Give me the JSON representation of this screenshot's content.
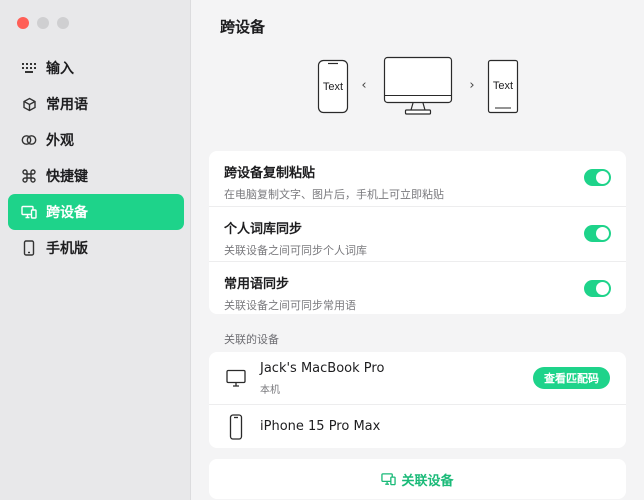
{
  "sidebar": {
    "items": [
      {
        "label": "输入",
        "icon": "keyboard-icon"
      },
      {
        "label": "常用语",
        "icon": "cube-icon"
      },
      {
        "label": "外观",
        "icon": "rings-icon"
      },
      {
        "label": "快捷键",
        "icon": "command-icon"
      },
      {
        "label": "跨设备",
        "icon": "devices-icon",
        "active": true
      },
      {
        "label": "手机版",
        "icon": "phone-icon"
      }
    ]
  },
  "main": {
    "title": "跨设备",
    "illustration": {
      "left_phone_text": "Text",
      "right_phone_text": "Text",
      "prev_arrow": "‹",
      "next_arrow": "›"
    },
    "settings": [
      {
        "title": "跨设备复制粘贴",
        "subtitle": "在电脑复制文字、图片后，手机上可立即粘贴",
        "enabled": true
      },
      {
        "title": "个人词库同步",
        "subtitle": "关联设备之间可同步个人词库",
        "enabled": true
      },
      {
        "title": "常用语同步",
        "subtitle": "关联设备之间可同步常用语",
        "enabled": true
      }
    ],
    "devices_label": "关联的设备",
    "devices": [
      {
        "name": "Jack's MacBook Pro",
        "sub": "本机",
        "button": "查看匹配码"
      },
      {
        "name": "iPhone 15 Pro Max"
      }
    ],
    "link_button": "关联设备"
  },
  "colors": {
    "accent": "#1ed38a",
    "accent_text": "#1aba78",
    "sidebar_bg": "#e8e8ea"
  }
}
